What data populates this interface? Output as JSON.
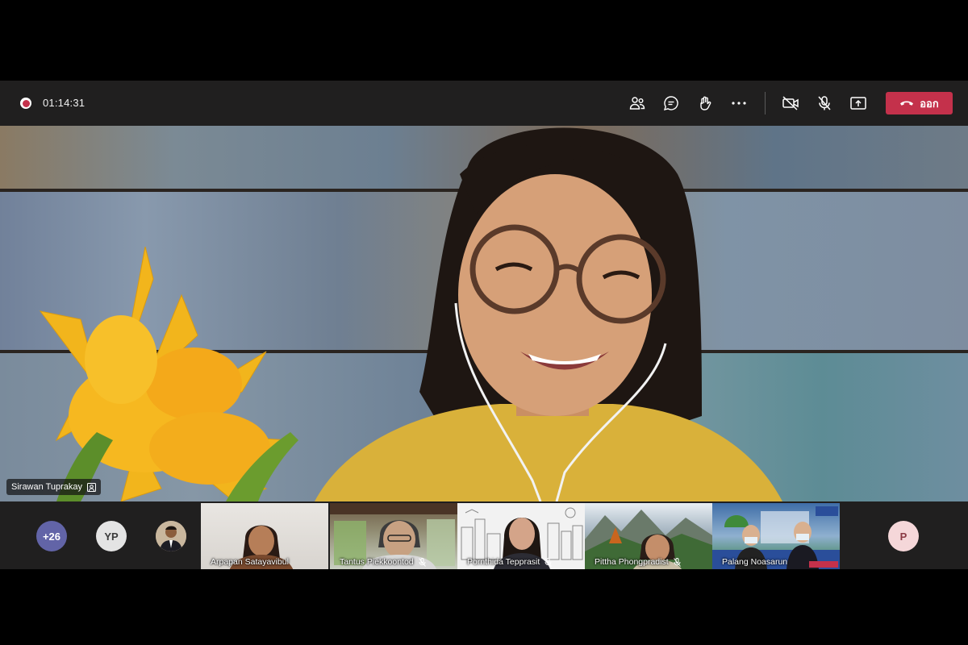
{
  "call": {
    "timer": "01:14:31",
    "leave_label": "ออก"
  },
  "toolbar": {
    "icons": [
      "people-icon",
      "chat-icon",
      "raise-hand-icon",
      "more-icon",
      "camera-off-icon",
      "mic-off-icon",
      "share-screen-icon"
    ]
  },
  "main_video": {
    "speaker_name": "Sirawan Tuprakay"
  },
  "strip": {
    "overflow_count": "+26",
    "avatar_initials_1": "YP",
    "avatar_initials_2": "P",
    "participants": [
      {
        "name": "Arpapan Satayavibul"
      },
      {
        "name": "Tantus Piekkoontod"
      },
      {
        "name": "Pornthida Tepprasit"
      },
      {
        "name": "Pittha Phongpradist"
      },
      {
        "name": "Palang Noasarun"
      }
    ]
  },
  "colors": {
    "toolbar_bg": "#201f1f",
    "leave_button": "#c4314b",
    "overflow_avatar": "#6264a7",
    "initials_avatar": "#e4e4e4",
    "p_avatar": "#f5d7d9"
  }
}
